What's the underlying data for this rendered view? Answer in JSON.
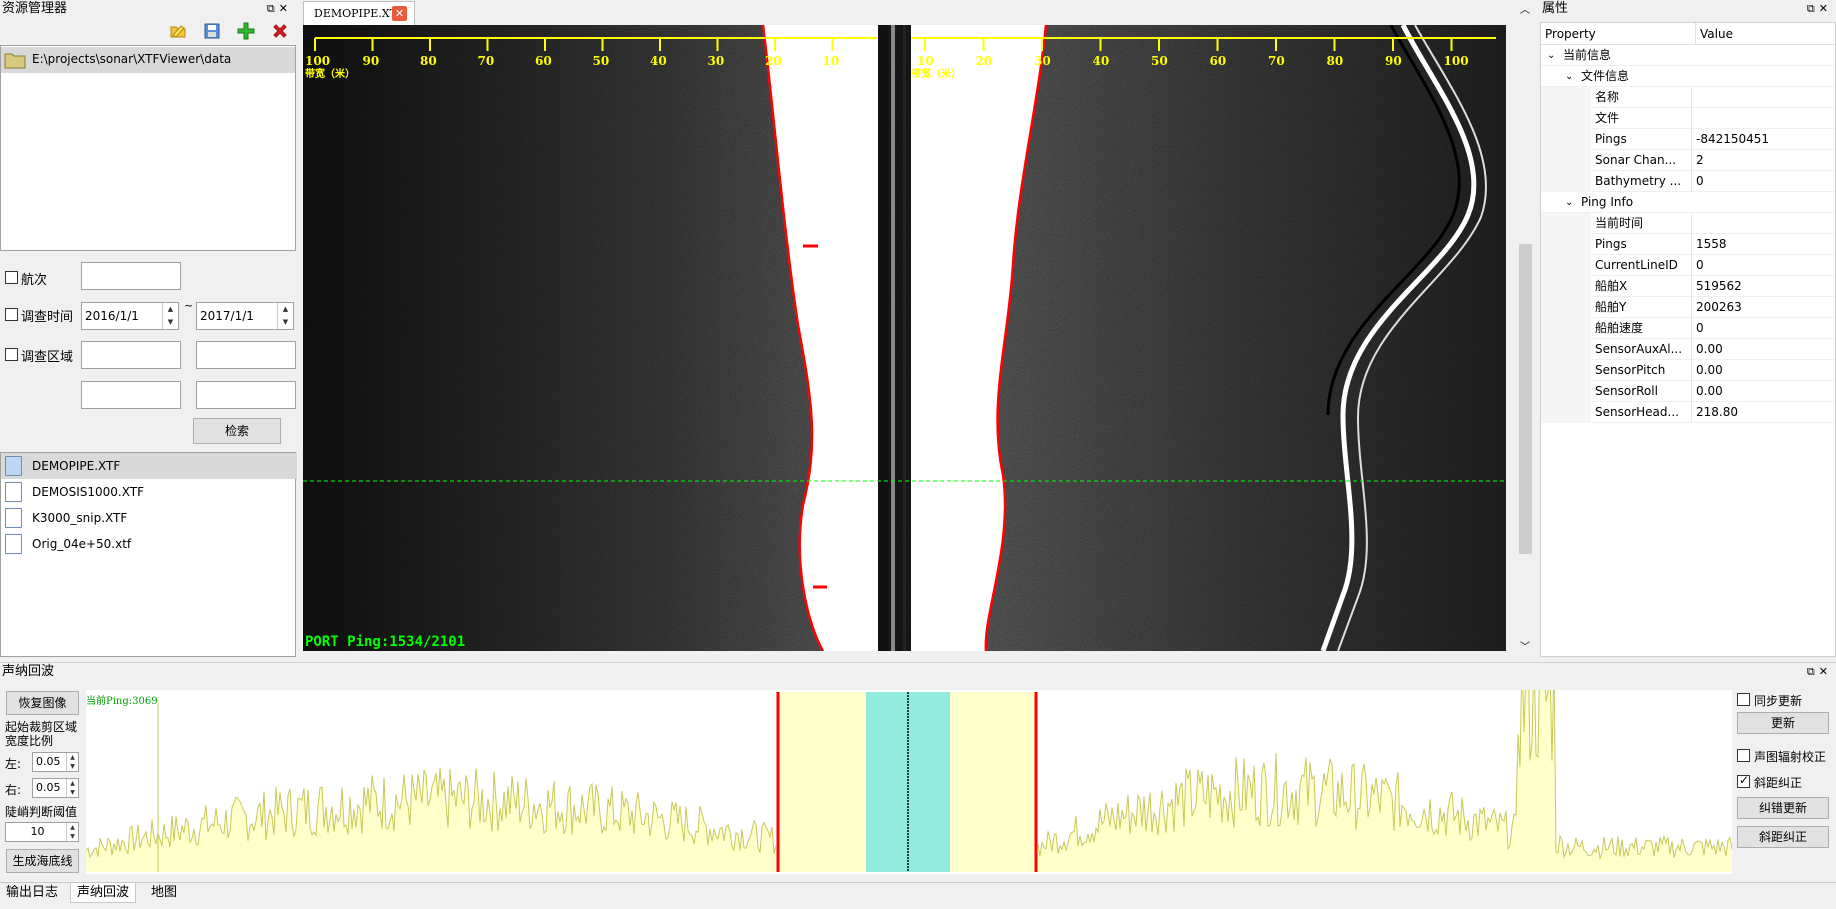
{
  "explorer": {
    "title": "资源管理器",
    "path": "E:\\projects\\sonar\\XTFViewer\\data",
    "filters": {
      "voyage_label": "航次",
      "survey_time_label": "调查时间",
      "survey_area_label": "调查区域",
      "start_date": "2016/1/1",
      "end_date": "2017/1/1",
      "date_sep": "~",
      "search_button": "检索"
    },
    "files": [
      {
        "name": "DEMOPIPE.XTF"
      },
      {
        "name": "DEMOSIS1000.XTF"
      },
      {
        "name": "K3000_snip.XTF"
      },
      {
        "name": "Orig_04e+50.xtf"
      }
    ]
  },
  "viewer": {
    "tab_label": "DEMOPIPE.XTF",
    "port_axis_ticks": [
      "100",
      "90",
      "80",
      "70",
      "60",
      "50",
      "40",
      "30",
      "20",
      "10"
    ],
    "stbd_axis_ticks": [
      "10",
      "20",
      "30",
      "40",
      "50",
      "60",
      "70",
      "80",
      "90",
      "100"
    ],
    "port_axis_unit": "带宽（米）",
    "stbd_axis_unit": "带宽（米）",
    "status": "PORT Ping:1534/2101",
    "colors": {
      "axis": "#ffff00",
      "bottom_track": "#ff0000",
      "ping_line": "#00ff00",
      "status": "#00ff00"
    }
  },
  "properties": {
    "title": "属性",
    "col_property": "Property",
    "col_value": "Value",
    "rows": [
      {
        "name": "当前信息",
        "value": "",
        "level": 0,
        "group": true
      },
      {
        "name": "文件信息",
        "value": "",
        "level": 1,
        "group": true
      },
      {
        "name": "名称",
        "value": "",
        "level": 2
      },
      {
        "name": "文件",
        "value": "",
        "level": 2
      },
      {
        "name": "Pings",
        "value": "-842150451",
        "level": 2
      },
      {
        "name": "Sonar Chan...",
        "value": "2",
        "level": 2
      },
      {
        "name": "Bathymetry ...",
        "value": "0",
        "level": 2
      },
      {
        "name": "Ping Info",
        "value": "",
        "level": 1,
        "group": true
      },
      {
        "name": "当前时间",
        "value": "",
        "level": 2
      },
      {
        "name": "Pings",
        "value": "1558",
        "level": 2
      },
      {
        "name": "CurrentLineID",
        "value": "0",
        "level": 2
      },
      {
        "name": "船舶X",
        "value": "519562",
        "level": 2
      },
      {
        "name": "船舶Y",
        "value": "200263",
        "level": 2
      },
      {
        "name": "船舶速度",
        "value": "0",
        "level": 2
      },
      {
        "name": "SensorAuxAl...",
        "value": "0.00",
        "level": 2
      },
      {
        "name": "SensorPitch",
        "value": "0.00",
        "level": 2
      },
      {
        "name": "SensorRoll",
        "value": "0.00",
        "level": 2
      },
      {
        "name": "SensorHead...",
        "value": "218.80",
        "level": 2
      }
    ]
  },
  "echo": {
    "title": "声纳回波",
    "restore_button": "恢复图像",
    "crop_label_1": "起始裁剪区域",
    "crop_label_2": "宽度比例",
    "left_label": "左:",
    "left_value": "0.05",
    "right_label": "右:",
    "right_value": "0.05",
    "threshold_label": "陡峭判断阈值",
    "threshold_value": "10",
    "gen_seabed_button": "生成海底线",
    "current_ping": "当前Ping:3069",
    "sync_update_label": "同步更新",
    "update_button": "更新",
    "radiometric_label": "声图辐射校正",
    "slant_label": "斜距纠正",
    "correction_update_button": "纠错更新",
    "slant_button": "斜距纠正",
    "colors": {
      "signal": "#c8c85a",
      "fill": "#ffffcc",
      "marker": "#ff0000",
      "selection": "#7ee8e0"
    }
  },
  "bottom_tabs": [
    "输出日志",
    "声纳回波",
    "地图"
  ]
}
